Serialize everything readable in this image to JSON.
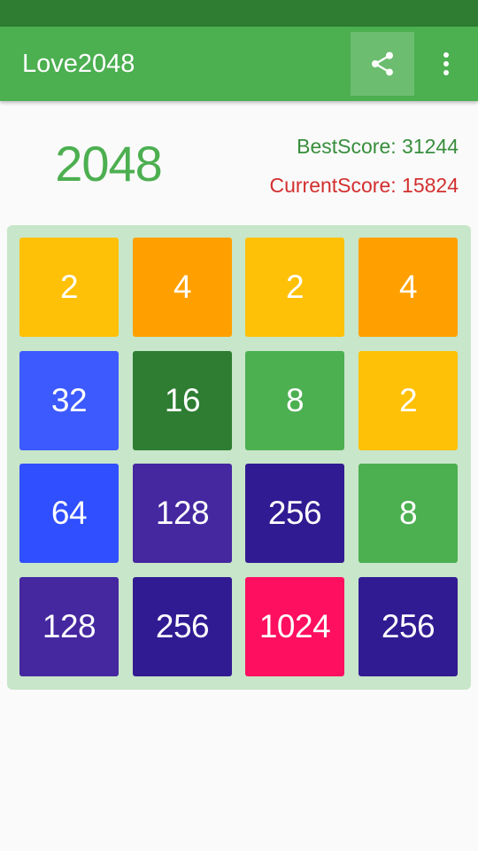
{
  "app": {
    "title": "Love2048"
  },
  "toolbar": {
    "share_icon": "share-icon",
    "more_icon": "more-vert-icon"
  },
  "header": {
    "game_title": "2048",
    "best_score": "BestScore: 31244",
    "current_score": "CurrentScore: 15824"
  },
  "colors": {
    "primary": "#4caf50",
    "primary_dark": "#2e7d32",
    "board_bg": "#c8e6c9",
    "best_score_text": "#388e3c",
    "current_score_text": "#d32f2f"
  },
  "board": {
    "rows": [
      [
        {
          "value": "2",
          "color": "#ffc107"
        },
        {
          "value": "4",
          "color": "#ffa000"
        },
        {
          "value": "2",
          "color": "#ffc107"
        },
        {
          "value": "4",
          "color": "#ffa000"
        }
      ],
      [
        {
          "value": "32",
          "color": "#3d5afe"
        },
        {
          "value": "16",
          "color": "#2e7d32"
        },
        {
          "value": "8",
          "color": "#4caf50"
        },
        {
          "value": "2",
          "color": "#ffc107"
        }
      ],
      [
        {
          "value": "64",
          "color": "#304ffe"
        },
        {
          "value": "128",
          "color": "#4527a0"
        },
        {
          "value": "256",
          "color": "#311b92"
        },
        {
          "value": "8",
          "color": "#4caf50"
        }
      ],
      [
        {
          "value": "128",
          "color": "#4527a0"
        },
        {
          "value": "256",
          "color": "#311b92"
        },
        {
          "value": "1024",
          "color": "#ff0f5f"
        },
        {
          "value": "256",
          "color": "#311b92"
        }
      ]
    ]
  }
}
